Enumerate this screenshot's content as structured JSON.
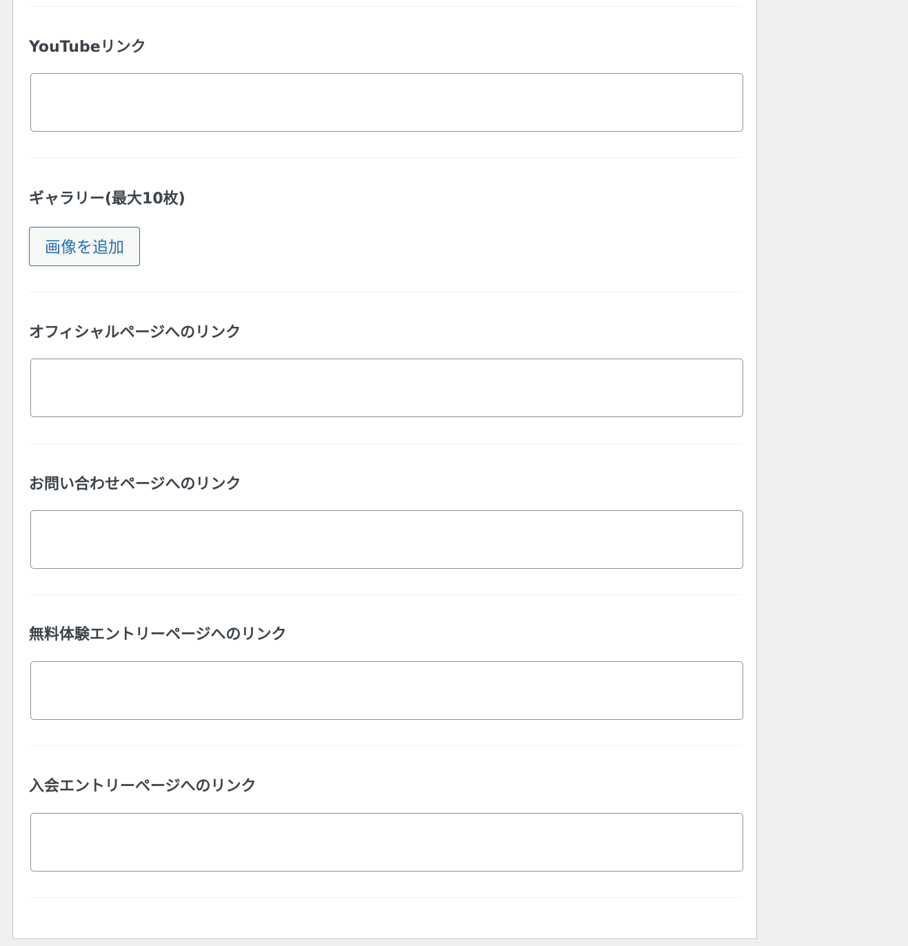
{
  "fields": {
    "youtube": {
      "label": "YouTubeリンク",
      "value": ""
    },
    "gallery": {
      "label": "ギャラリー(最大10枚)",
      "button_label": "画像を追加"
    },
    "official": {
      "label": "オフィシャルページへのリンク",
      "value": ""
    },
    "contact": {
      "label": "お問い合わせページへのリンク",
      "value": ""
    },
    "free_trial": {
      "label": "無料体験エントリーページへのリンク",
      "value": ""
    },
    "membership": {
      "label": "入会エントリーページへのリンク",
      "value": ""
    }
  }
}
